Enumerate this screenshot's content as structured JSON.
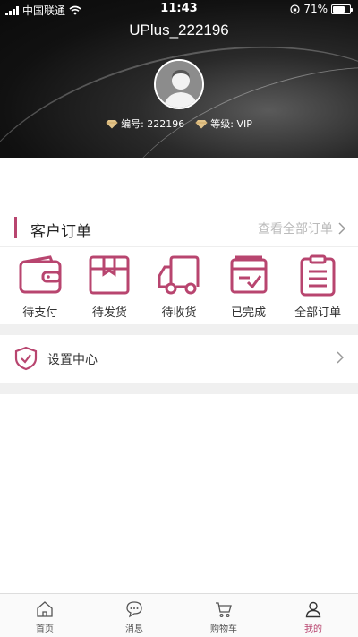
{
  "status_bar": {
    "carrier": "中国联通",
    "time": "11:43",
    "battery": "71%",
    "battery_level": 0.71
  },
  "profile": {
    "username": "UPlus_222196",
    "number_label": "编号: 222196",
    "level_label": "等级: VIP"
  },
  "orders": {
    "title": "客户订单",
    "view_all": "查看全部订单",
    "items": [
      {
        "label": "待支付",
        "icon": "wallet-icon"
      },
      {
        "label": "待发货",
        "icon": "box-icon"
      },
      {
        "label": "待收货",
        "icon": "truck-icon"
      },
      {
        "label": "已完成",
        "icon": "completed-icon"
      },
      {
        "label": "全部订单",
        "icon": "clipboard-icon"
      }
    ]
  },
  "settings": {
    "label": "设置中心"
  },
  "tabbar": {
    "items": [
      {
        "label": "首页",
        "icon": "home-icon"
      },
      {
        "label": "消息",
        "icon": "message-icon"
      },
      {
        "label": "购物车",
        "icon": "cart-icon"
      },
      {
        "label": "我的",
        "icon": "user-icon"
      }
    ],
    "active": "我的"
  },
  "colors": {
    "accent": "#b8456f",
    "muted": "#bbbbbb"
  }
}
